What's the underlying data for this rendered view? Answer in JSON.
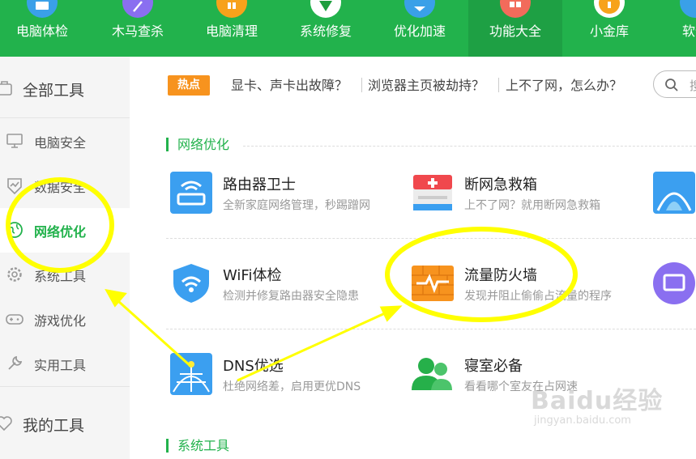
{
  "top_nav": [
    {
      "label": "电脑体检",
      "icon": "monitor-icon",
      "color": "#3aa0e8",
      "active": false
    },
    {
      "label": "木马查杀",
      "icon": "feather-icon",
      "color": "#8a6ff0",
      "active": false
    },
    {
      "label": "电脑清理",
      "icon": "broom-icon",
      "color": "#f7a21b",
      "active": false
    },
    {
      "label": "系统修复",
      "icon": "shield-icon",
      "color": "#1d9e3e",
      "active": false
    },
    {
      "label": "优化加速",
      "icon": "rocket-icon",
      "color": "#3aa0e8",
      "active": false
    },
    {
      "label": "功能大全",
      "icon": "grid-icon",
      "color": "#f26b5b",
      "active": true
    },
    {
      "label": "小金库",
      "icon": "coin-icon",
      "color": "#f7a21b",
      "active": false
    },
    {
      "label": "软件",
      "icon": "app-icon",
      "color": "#3aa0e8",
      "active": false
    }
  ],
  "sidebar": {
    "header": {
      "label": "全部工具",
      "icon": "toolbox-icon"
    },
    "items": [
      {
        "label": "电脑安全",
        "icon": "computer-icon",
        "active": false
      },
      {
        "label": "数据安全",
        "icon": "chart-icon",
        "active": false
      },
      {
        "label": "网络优化",
        "icon": "globe-icon",
        "active": true
      },
      {
        "label": "系统工具",
        "icon": "gear-icon",
        "active": false
      },
      {
        "label": "游戏优化",
        "icon": "gamepad-icon",
        "active": false
      },
      {
        "label": "实用工具",
        "icon": "wrench-icon",
        "active": false
      }
    ],
    "my_tools": {
      "label": "我的工具",
      "icon": "heart-icon"
    }
  },
  "hot": {
    "badge": "热点",
    "links": [
      "显卡、声卡出故障？",
      "浏览器主页被劫持？",
      "上不了网，怎么办？"
    ]
  },
  "search": {
    "placeholder": "搜"
  },
  "sections": [
    {
      "title": "网络优化",
      "tools": [
        {
          "name": "路由器卫士",
          "desc": "全新家庭网络管理，秒踢蹭网",
          "icon": "router-icon"
        },
        {
          "name": "断网急救箱",
          "desc": "上不了网？就用断网急救箱",
          "icon": "first-aid-kit-icon"
        },
        {
          "name": "",
          "desc": "",
          "icon": "network-icon"
        },
        {
          "name": "WiFi体检",
          "desc": "检测并修复路由器安全隐患",
          "icon": "wifi-shield-icon"
        },
        {
          "name": "流量防火墙",
          "desc": "发现并阻止偷偷占流量的程序",
          "icon": "firewall-icon"
        },
        {
          "name": "",
          "desc": "",
          "icon": "monitor-icon"
        },
        {
          "name": "DNS优选",
          "desc": "杜绝网络差，启用更优DNS",
          "icon": "dns-globe-icon"
        },
        {
          "name": "寝室必备",
          "desc": "看看哪个室友在占网速",
          "icon": "roommates-icon"
        }
      ]
    },
    {
      "title": "系统工具",
      "tools": []
    }
  ],
  "watermark": {
    "main": "Baidu经验",
    "sub": "jingyan.baidu.com"
  },
  "colors": {
    "brand_green": "#22b24c",
    "hot_orange": "#f7931e",
    "annotation_yellow": "#ffff00"
  }
}
